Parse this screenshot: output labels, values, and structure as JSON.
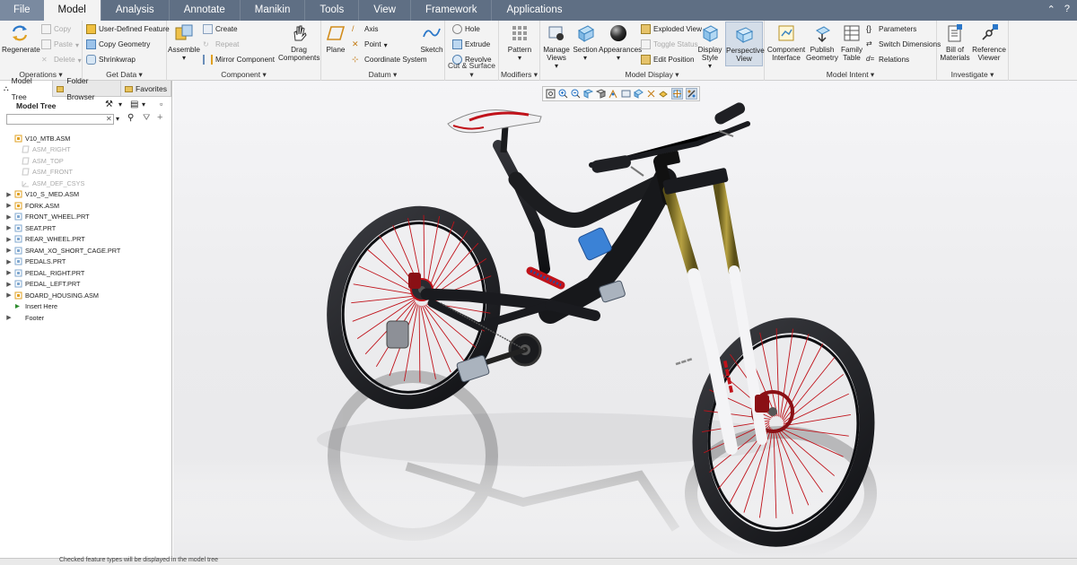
{
  "menu": {
    "tabs": [
      {
        "label": "File"
      },
      {
        "label": "Model"
      },
      {
        "label": "Analysis"
      },
      {
        "label": "Annotate"
      },
      {
        "label": "Manikin"
      },
      {
        "label": "Tools"
      },
      {
        "label": "View"
      },
      {
        "label": "Framework"
      },
      {
        "label": "Applications"
      }
    ],
    "active_tab": "Model"
  },
  "ribbon": {
    "operations": {
      "regenerate": "Regenerate",
      "copy": "Copy",
      "paste": "Paste",
      "delete": "Delete",
      "label": "Operations ▾"
    },
    "get_data": {
      "udf": "User-Defined Feature",
      "copy_geometry": "Copy Geometry",
      "shrinkwrap": "Shrinkwrap",
      "label": "Get Data ▾"
    },
    "component": {
      "assemble": "Assemble",
      "create": "Create",
      "repeat": "Repeat",
      "mirror": "Mirror Component",
      "drag": "Drag Components",
      "label": "Component ▾"
    },
    "datum": {
      "plane": "Plane",
      "axis": "Axis",
      "point": "Point",
      "csys": "Coordinate System",
      "sketch": "Sketch",
      "label": "Datum ▾"
    },
    "cut_surface": {
      "hole": "Hole",
      "extrude": "Extrude",
      "revolve": "Revolve",
      "label": "Cut & Surface ▾"
    },
    "modifiers": {
      "pattern": "Pattern",
      "label": "Modifiers ▾"
    },
    "model_display": {
      "manage_views": "Manage Views",
      "section": "Section",
      "appearances": "Appearances",
      "exploded_view": "Exploded View",
      "toggle_status": "Toggle Status",
      "edit_position": "Edit Position",
      "display_style": "Display Style",
      "perspective_view": "Perspective View",
      "label": "Model Display ▾"
    },
    "model_intent": {
      "component_interface": "Component Interface",
      "publish_geometry": "Publish Geometry",
      "family_table": "Family Table",
      "parameters": "Parameters",
      "switch_dimensions": "Switch Dimensions",
      "relations": "Relations",
      "label": "Model Intent ▾"
    },
    "investigate": {
      "bom": "Bill of Materials",
      "reference_viewer": "Reference Viewer",
      "label": "Investigate ▾"
    }
  },
  "panel": {
    "tabs": [
      {
        "label": "Model Tree"
      },
      {
        "label": "Folder Browser"
      },
      {
        "label": "Favorites"
      }
    ],
    "tree_title": "Model Tree",
    "search_value": ""
  },
  "tree": [
    {
      "label": "V10_MTB.ASM",
      "kind": "asm",
      "exp": "",
      "dim": false
    },
    {
      "label": "ASM_RIGHT",
      "kind": "datum",
      "exp": "",
      "dim": true
    },
    {
      "label": "ASM_TOP",
      "kind": "datum",
      "exp": "",
      "dim": true
    },
    {
      "label": "ASM_FRONT",
      "kind": "datum",
      "exp": "",
      "dim": true
    },
    {
      "label": "ASM_DEF_CSYS",
      "kind": "csys",
      "exp": "",
      "dim": true
    },
    {
      "label": "V10_S_MED.ASM",
      "kind": "asm",
      "exp": "▶",
      "dim": false
    },
    {
      "label": "FORK.ASM",
      "kind": "asm",
      "exp": "▶",
      "dim": false
    },
    {
      "label": "FRONT_WHEEL.PRT",
      "kind": "prt",
      "exp": "▶",
      "dim": false
    },
    {
      "label": "SEAT.PRT",
      "kind": "prt",
      "exp": "▶",
      "dim": false
    },
    {
      "label": "REAR_WHEEL.PRT",
      "kind": "prt",
      "exp": "▶",
      "dim": false
    },
    {
      "label": "SRAM_XO_SHORT_CAGE.PRT",
      "kind": "prt",
      "exp": "▶",
      "dim": false
    },
    {
      "label": "PEDALS.PRT",
      "kind": "prt",
      "exp": "▶",
      "dim": false
    },
    {
      "label": "PEDAL_RIGHT.PRT",
      "kind": "prt",
      "exp": "▶",
      "dim": false
    },
    {
      "label": "PEDAL_LEFT.PRT",
      "kind": "prt",
      "exp": "▶",
      "dim": false
    },
    {
      "label": "BOARD_HOUSING.ASM",
      "kind": "asm",
      "exp": "▶",
      "dim": false
    },
    {
      "label": "Insert Here",
      "kind": "insert",
      "exp": "",
      "dim": false
    },
    {
      "label": "Footer",
      "kind": "footer",
      "exp": "▶",
      "dim": false
    }
  ],
  "status_text": "Checked feature types will be displayed in the model tree",
  "colors": {
    "menubar": "#5f6f84",
    "frame_black": "#1c1d20",
    "spoke_red": "#c0121a",
    "fork_gold": "#8a7a2c"
  }
}
